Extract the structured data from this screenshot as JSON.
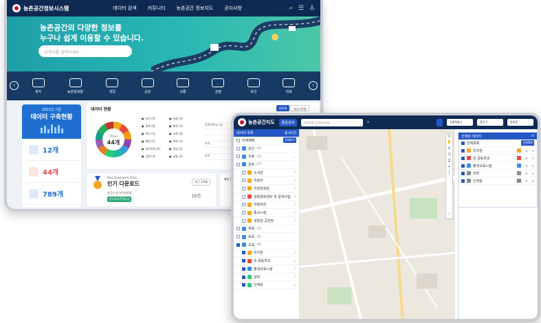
{
  "portal": {
    "brand": "농촌공간정보시스템",
    "nav": [
      "데이터 검색",
      "커뮤니티",
      "농촌공간 정보지도",
      "공지사항"
    ],
    "hero_title": "농촌공간의 다양한 정보를\n누구나 쉽게 이용할 수 있습니다.",
    "search_placeholder": "검색어를 입력하세요.",
    "categories": [
      "복지",
      "농촌융복합",
      "생업",
      "공원",
      "교통",
      "관광",
      "보건",
      "자료"
    ],
    "stat": {
      "year": "2022년 기준",
      "title": "데이터 구축현황",
      "rows": [
        {
          "label": "",
          "value": "12개"
        },
        {
          "label": "",
          "value": "44개"
        },
        {
          "label": "",
          "value": "789개"
        }
      ]
    },
    "dataset_panel": {
      "title": "데이터 현황",
      "tab_active": "분류별",
      "tab_other": "제공기관별",
      "total_label": "Total",
      "total_value": "44개",
      "legend": [
        {
          "label": "보건 (4)",
          "color": "#f5a623"
        },
        {
          "label": "의료 (3)",
          "color": "#e74c3c"
        },
        {
          "label": "문화 (9)",
          "color": "#f39c12"
        },
        {
          "label": "체육 (3)",
          "color": "#8e44ad"
        },
        {
          "label": "복지 (5)",
          "color": "#3498db"
        },
        {
          "label": "교육 (6)",
          "color": "#1abc9c"
        },
        {
          "label": "행정 (5)",
          "color": "#2ecc71"
        },
        {
          "label": "복지 (3)",
          "color": "#e67e22"
        },
        {
          "label": "여가휴게 (4)",
          "color": "#9b59b6"
        },
        {
          "label": "생업 (2)",
          "color": "#16a085"
        },
        {
          "label": "공원 (3)",
          "color": "#27ae60"
        },
        {
          "label": "교통 (2)",
          "color": "#c0392b"
        }
      ],
      "table_rows": [
        "",
        "장애인복지시설",
        "",
        "",
        "보육",
        "",
        "보육"
      ]
    },
    "downloads": {
      "subtitle": "Best Downloads Data",
      "title": "인기 다운로드",
      "select": "최근 1개월",
      "item": "보건소 및 보건지료원",
      "badge": "한국토지주택공사",
      "count": "15건"
    },
    "side_card": {
      "title": "최신 업로"
    }
  },
  "mapapp": {
    "brand": "농촌공간지도",
    "button": "통합검색",
    "search_placeholder": "검색어를 입력해주세요",
    "selects": [
      "서울특별시",
      "용산구",
      "효창동"
    ],
    "sidebar": {
      "header": "데이터 목록",
      "header_count": "총 61건",
      "all_label": "전체해제",
      "all_btn": "전체보기",
      "groups": [
        {
          "label": "보건",
          "count": "(4)",
          "color": "#3a8ee6",
          "on": false,
          "sub": false
        },
        {
          "label": "의료",
          "count": "(3)",
          "color": "#3a8ee6",
          "on": false,
          "sub": false
        },
        {
          "label": "문화",
          "count": "(7)",
          "color": "#3a8ee6",
          "on": false,
          "sub": false
        },
        {
          "label": "도서관",
          "color": "#f5a623",
          "on": false,
          "sub": true
        },
        {
          "label": "미술관",
          "color": "#f5a623",
          "on": false,
          "sub": true
        },
        {
          "label": "지방문화원",
          "color": "#f5a623",
          "on": false,
          "sub": true
        },
        {
          "label": "생활문화센터 및 문화의집",
          "color": "#e74c3c",
          "on": false,
          "sub": true
        },
        {
          "label": "마을회관",
          "color": "#f5a623",
          "on": false,
          "sub": true
        },
        {
          "label": "종교시설",
          "color": "#f5a623",
          "on": false,
          "sub": true
        },
        {
          "label": "생활권 공연장",
          "color": "#f5a623",
          "on": false,
          "sub": true
        },
        {
          "label": "체육",
          "count": "(3)",
          "color": "#3a8ee6",
          "on": false,
          "sub": false
        },
        {
          "label": "보육",
          "count": "(5)",
          "color": "#3a8ee6",
          "on": false,
          "sub": false
        },
        {
          "label": "교육",
          "count": "(6)",
          "color": "#3a8ee6",
          "on": true,
          "sub": false
        },
        {
          "label": "유치원",
          "color": "#f5a623",
          "on": true,
          "sub": true
        },
        {
          "label": "초·중등학교",
          "color": "#e74c3c",
          "on": true,
          "sub": true
        },
        {
          "label": "평생교육시설",
          "color": "#3a8ee6",
          "on": true,
          "sub": true
        },
        {
          "label": "대학",
          "color": "#2ecc71",
          "on": true,
          "sub": true
        },
        {
          "label": "인재원",
          "color": "#2ecc71",
          "on": true,
          "sub": true
        }
      ]
    },
    "right": {
      "header": "선택된 데이터",
      "all_label": "전체목록",
      "all_btn": "전체해제",
      "items": [
        {
          "label": "유치원",
          "color": "#f5a623"
        },
        {
          "label": "초·중등학교",
          "color": "#e74c3c"
        },
        {
          "label": "평생교육시설",
          "color": "#3a8ee6"
        },
        {
          "label": "대학",
          "color": "#8e8e8e"
        },
        {
          "label": "인재원",
          "color": "#7f8c8d"
        }
      ]
    }
  }
}
